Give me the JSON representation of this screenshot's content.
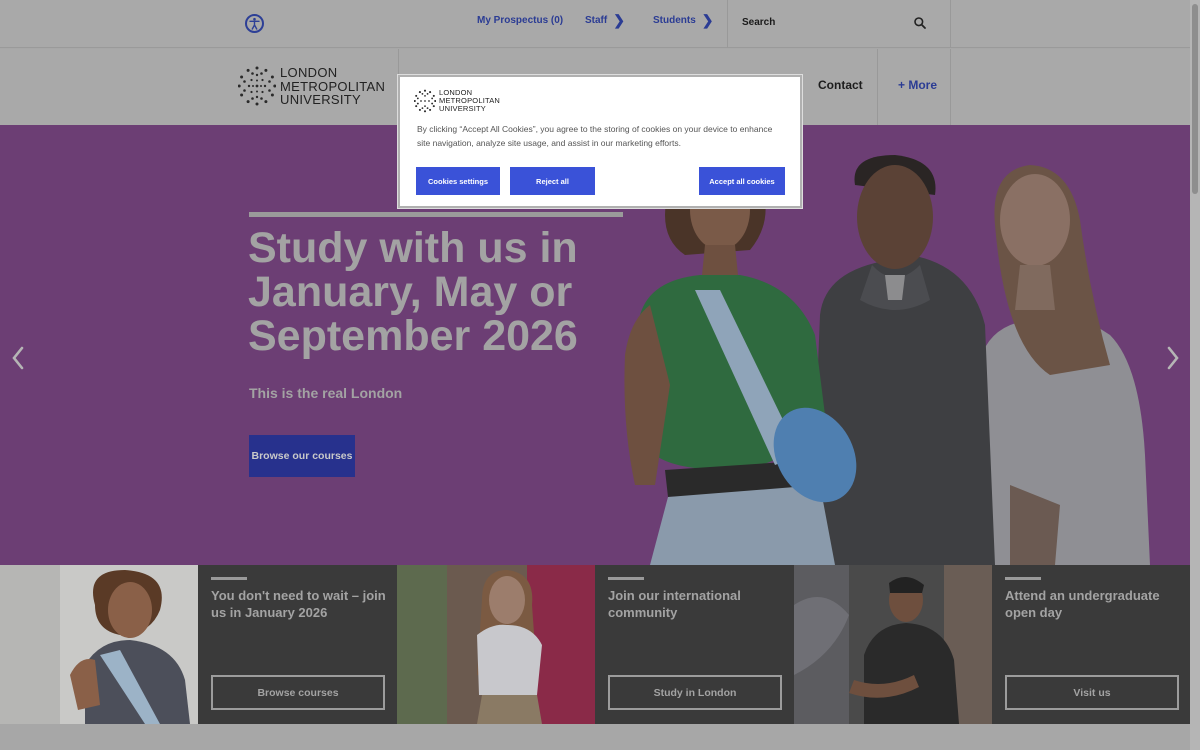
{
  "topbar": {
    "accessibility_icon": "accessibility-icon",
    "links": [
      {
        "label": "My Prospectus (0)",
        "chevron": false
      },
      {
        "label": "Staff",
        "chevron": true
      },
      {
        "label": "Students",
        "chevron": true
      }
    ],
    "search": {
      "placeholder": "Search",
      "icon": "search-icon"
    }
  },
  "nav": {
    "logo_lines": [
      "LONDON",
      "METROPOLITAN",
      "UNIVERSITY"
    ],
    "contact": "Contact",
    "more": "+ More"
  },
  "hero": {
    "title": "Study with us in January, May or September 2026",
    "subtitle": "This is the real London",
    "cta": "Browse our courses",
    "prev_icon": "chevron-left-icon",
    "next_icon": "chevron-right-icon",
    "background": "#6c3e74"
  },
  "cards": [
    {
      "title": "You don't need to wait – join us in January 2026",
      "button": "Browse courses"
    },
    {
      "title": "Join our international community",
      "button": "Study in London"
    },
    {
      "title": "Attend an undergraduate open day",
      "button": "Visit us"
    }
  ],
  "cookie_banner": {
    "logo_lines": [
      "LONDON",
      "METROPOLITAN",
      "UNIVERSITY"
    ],
    "text": "By clicking “Accept All Cookies”, you agree to the storing of cookies on your device to enhance site navigation, analyze site usage, and assist in our marketing efforts.",
    "settings": "Cookies settings",
    "reject": "Reject all",
    "accept": "Accept all cookies",
    "button_color": "#3a52d8"
  },
  "colors": {
    "accent": "#2b3c94",
    "card_panel": "#3a3a3a",
    "overlay_gray": "#a9a9a9"
  }
}
